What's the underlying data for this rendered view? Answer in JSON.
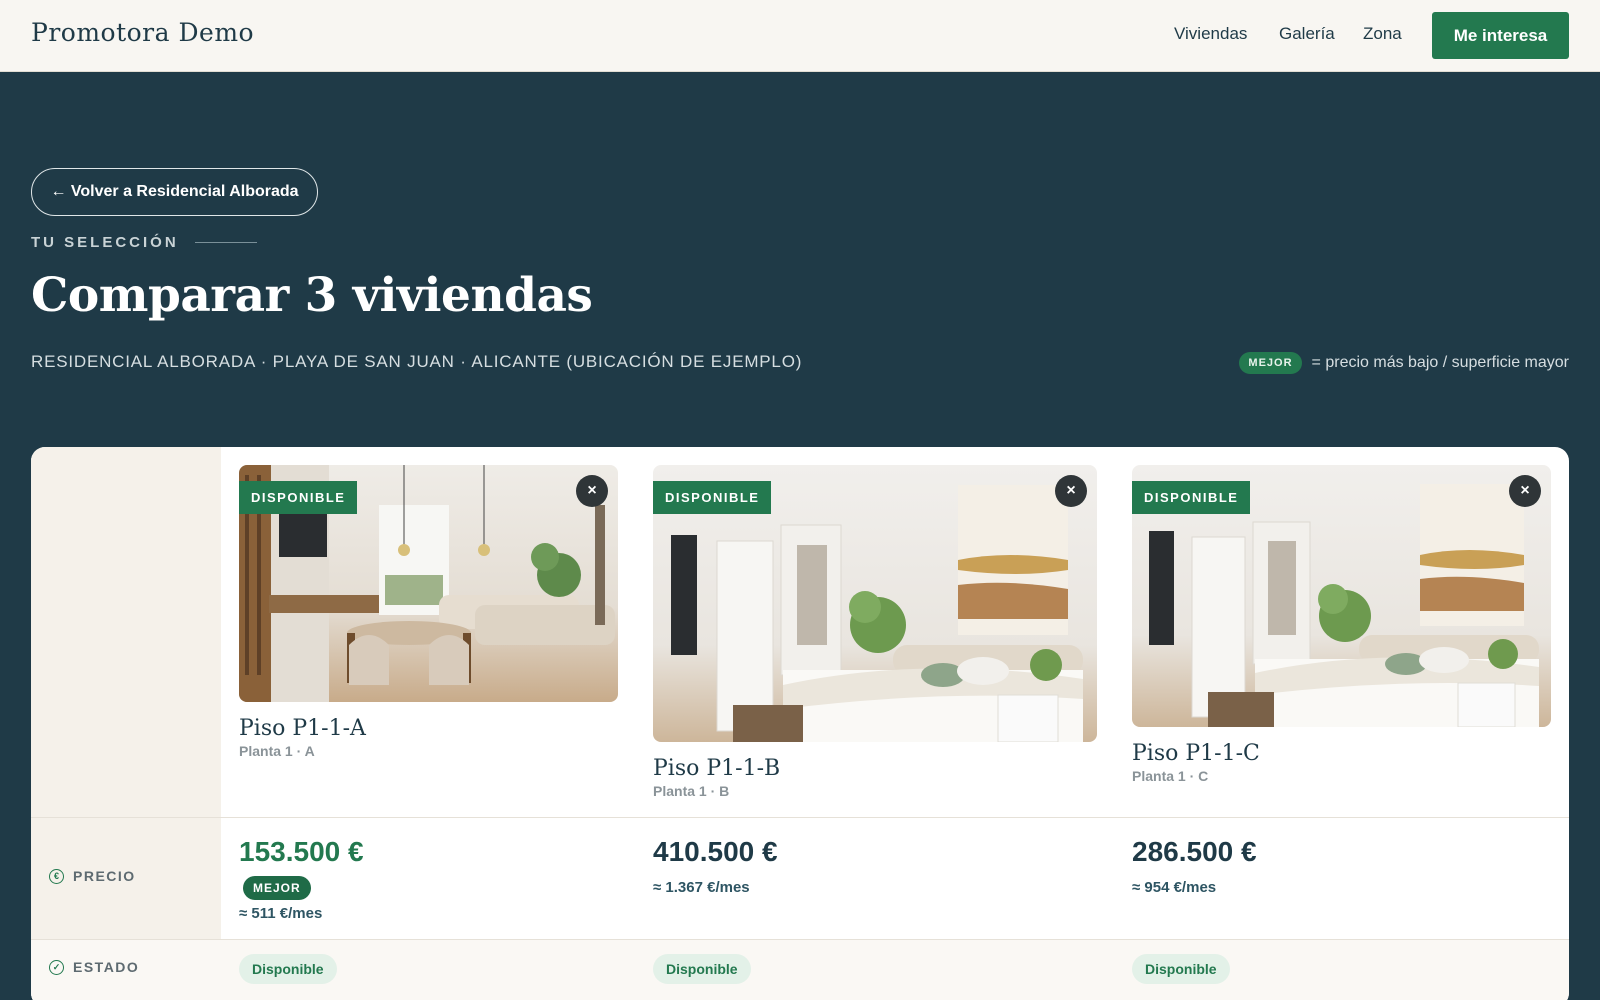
{
  "header": {
    "brand": "Promotora Demo",
    "nav": [
      "Viviendas",
      "Galería",
      "Zona"
    ],
    "cta": "Me interesa"
  },
  "hero": {
    "back": "← Volver a Residencial Alborada",
    "eyebrow": "TU SELECCIÓN",
    "title": "Comparar 3 viviendas",
    "subtitle": "RESIDENCIAL ALBORADA · PLAYA DE SAN JUAN · ALICANTE (UBICACIÓN DE EJEMPLO)",
    "legend_badge": "MEJOR",
    "legend_text": "= precio más bajo / superficie mayor"
  },
  "rows": {
    "price_label": "PRECIO",
    "status_label": "ESTADO",
    "best_badge": "MEJOR"
  },
  "units": [
    {
      "status_badge": "DISPONIBLE",
      "close": "×",
      "name": "Piso P1-1-A",
      "sub": "Planta 1 · A",
      "price": "153.500 €",
      "monthly": "≈ 511 €/mes",
      "status": "Disponible",
      "best": true
    },
    {
      "status_badge": "DISPONIBLE",
      "close": "×",
      "name": "Piso P1-1-B",
      "sub": "Planta 1 · B",
      "price": "410.500 €",
      "monthly": "≈ 1.367 €/mes",
      "status": "Disponible",
      "best": false
    },
    {
      "status_badge": "DISPONIBLE",
      "close": "×",
      "name": "Piso P1-1-C",
      "sub": "Planta 1 · C",
      "price": "286.500 €",
      "monthly": "≈ 954 €/mes",
      "status": "Disponible",
      "best": false
    }
  ],
  "colors": {
    "primary": "#1f3a47",
    "accent": "#23794f",
    "background": "#f8f6f2"
  }
}
